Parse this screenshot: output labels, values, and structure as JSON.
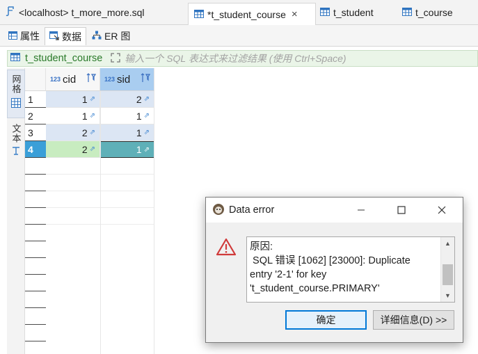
{
  "editor_tabs": [
    {
      "label": "<localhost> t_more_more.sql",
      "icon": "sql-script-icon",
      "active": false
    },
    {
      "label": "*t_student_course",
      "icon": "table-icon",
      "active": true,
      "close": "×"
    },
    {
      "label": "t_student",
      "icon": "table-icon",
      "active": false
    },
    {
      "label": "t_course",
      "icon": "table-icon",
      "active": false
    }
  ],
  "sub_tabs": [
    {
      "label": "属性",
      "icon": "properties-icon"
    },
    {
      "label": "数据",
      "icon": "data-icon"
    },
    {
      "label": "ER 图",
      "icon": "er-diagram-icon"
    }
  ],
  "filter": {
    "table_name": "t_student_course",
    "placeholder": "输入一个 SQL 表达式来过滤结果 (使用 Ctrl+Space)"
  },
  "side_panel": {
    "grid_label": "网格",
    "text_label": "文本"
  },
  "grid": {
    "columns": [
      {
        "name": "cid",
        "type_badge": "123"
      },
      {
        "name": "sid",
        "type_badge": "123"
      }
    ],
    "rows": [
      {
        "num": "1",
        "cid": "1",
        "sid": "2"
      },
      {
        "num": "2",
        "cid": "1",
        "sid": "1"
      },
      {
        "num": "3",
        "cid": "2",
        "sid": "1"
      },
      {
        "num": "4",
        "cid": "2",
        "sid": "1"
      }
    ]
  },
  "dialog": {
    "title": "Data error",
    "message_lines": [
      "原因:",
      " SQL 错误 [1062] [23000]: Duplicate",
      "entry '2-1' for key",
      "'t_student_course.PRIMARY'"
    ],
    "ok_label": "确定",
    "details_label": "详细信息(D) >>"
  },
  "colors": {
    "accent": "#3a9fd8",
    "filter_bg": "#eaf5e8",
    "new_row": "#c8ecc0",
    "selected_header": "#a9cdf0"
  }
}
